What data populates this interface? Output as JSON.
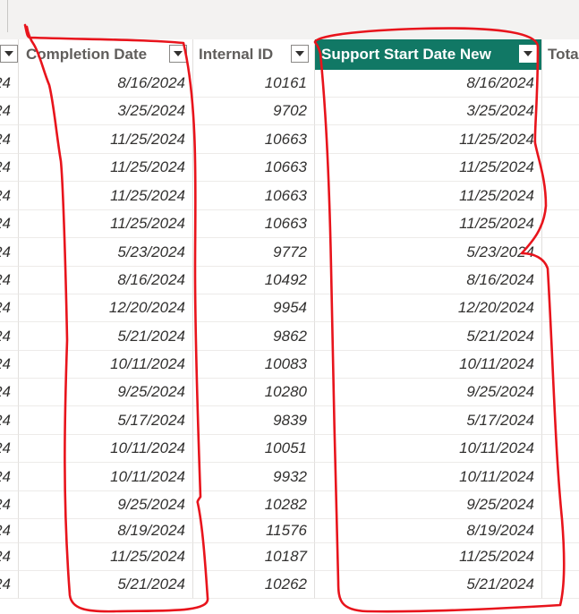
{
  "columns": {
    "partial_left": "",
    "completion_date": "Completion Date",
    "internal_id": "Internal ID",
    "support_start_date_new": "Support Start Date  New",
    "total_partial": "Tota"
  },
  "colors": {
    "selected_header_bg": "#117865",
    "annotation": "#e8141c"
  },
  "rows": [
    {
      "left": "24",
      "completion": "8/16/2024",
      "id": "10161",
      "support": "8/16/2024"
    },
    {
      "left": "24",
      "completion": "3/25/2024",
      "id": "9702",
      "support": "3/25/2024"
    },
    {
      "left": "24",
      "completion": "11/25/2024",
      "id": "10663",
      "support": "11/25/2024"
    },
    {
      "left": "24",
      "completion": "11/25/2024",
      "id": "10663",
      "support": "11/25/2024"
    },
    {
      "left": "24",
      "completion": "11/25/2024",
      "id": "10663",
      "support": "11/25/2024"
    },
    {
      "left": "24",
      "completion": "11/25/2024",
      "id": "10663",
      "support": "11/25/2024"
    },
    {
      "left": "24",
      "completion": "5/23/2024",
      "id": "9772",
      "support": "5/23/2024"
    },
    {
      "left": "24",
      "completion": "8/16/2024",
      "id": "10492",
      "support": "8/16/2024"
    },
    {
      "left": "24",
      "completion": "12/20/2024",
      "id": "9954",
      "support": "12/20/2024"
    },
    {
      "left": "24",
      "completion": "5/21/2024",
      "id": "9862",
      "support": "5/21/2024"
    },
    {
      "left": "24",
      "completion": "10/11/2024",
      "id": "10083",
      "support": "10/11/2024"
    },
    {
      "left": "24",
      "completion": "9/25/2024",
      "id": "10280",
      "support": "9/25/2024"
    },
    {
      "left": "24",
      "completion": "5/17/2024",
      "id": "9839",
      "support": "5/17/2024"
    },
    {
      "left": "24",
      "completion": "10/11/2024",
      "id": "10051",
      "support": "10/11/2024"
    },
    {
      "left": "24",
      "completion": "10/11/2024",
      "id": "9932",
      "support": "10/11/2024"
    },
    {
      "left": "24",
      "completion": "9/25/2024",
      "id": "10282",
      "support": "9/25/2024"
    },
    {
      "left": "24",
      "completion": "8/19/2024",
      "id": "11576",
      "support": "8/19/2024"
    },
    {
      "left": "24",
      "completion": "11/25/2024",
      "id": "10187",
      "support": "11/25/2024"
    },
    {
      "left": "24",
      "completion": "5/21/2024",
      "id": "10262",
      "support": "5/21/2024"
    }
  ]
}
